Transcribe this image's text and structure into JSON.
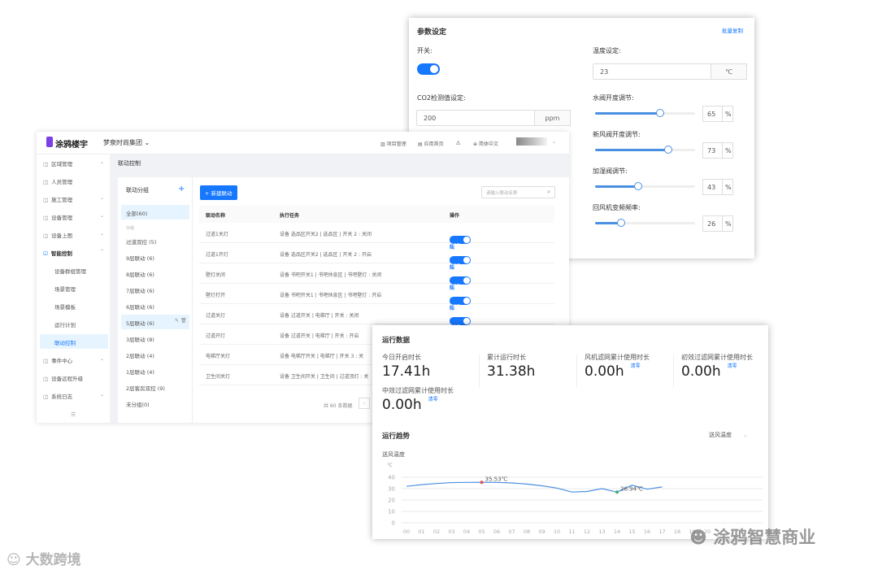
{
  "colors": {
    "accent": "#1677ff",
    "line": "#4a90e2",
    "max_point": "#e05555",
    "min_point": "#3cb371"
  },
  "header": {
    "logo": "涂鸦楼宇",
    "org": "梦泉时尚集团",
    "nav": [
      "项目管理",
      "应用首页"
    ],
    "language": "简体中文"
  },
  "sidebar": {
    "items": [
      {
        "label": "区域管理",
        "icon": "building-icon",
        "chevron": true
      },
      {
        "label": "人员管理",
        "icon": "user-icon"
      },
      {
        "label": "施工管理",
        "icon": "construction-icon",
        "chevron": true
      },
      {
        "label": "设备管理",
        "icon": "device-icon",
        "chevron": true
      },
      {
        "label": "设备上图",
        "icon": "map-pin-icon",
        "chevron": true
      },
      {
        "label": "智能控制",
        "icon": "smart-control-icon",
        "chevron": true,
        "expanded": true
      },
      {
        "label": "设备群组管理",
        "sub": true
      },
      {
        "label": "场景管理",
        "sub": true
      },
      {
        "label": "场景模板",
        "sub": true
      },
      {
        "label": "运行计划",
        "sub": true
      },
      {
        "label": "联动控制",
        "sub": true,
        "active": true
      },
      {
        "label": "事件中心",
        "icon": "event-icon",
        "chevron": true
      },
      {
        "label": "设备远程升级",
        "icon": "upgrade-icon"
      },
      {
        "label": "系统日志",
        "icon": "log-icon",
        "chevron": true
      }
    ]
  },
  "breadcrumb": "联动控制",
  "groups": {
    "title": "联动分组",
    "all": "全部(60)",
    "section": "分组",
    "items": [
      "过道双控 (5)",
      "9层联动 (6)",
      "8层联动 (6)",
      "7层联动 (6)",
      "6层联动 (6)",
      "5层联动 (6)",
      "3层联动 (8)",
      "2层联动 (4)",
      "1层联动 (4)",
      "2层客房双控 (9)",
      "未分组(0)"
    ]
  },
  "table": {
    "new_button": "+ 新建联动",
    "search_placeholder": "请输入联动名称",
    "columns": [
      "联动名称",
      "执行任务",
      "操作"
    ],
    "rows": [
      {
        "name": "过道1关灯",
        "task": "设备 选品区开关2 | 选品区 | 开关 2 : 关闭"
      },
      {
        "name": "过道1开灯",
        "task": "设备 选品区开关2 | 选品区 | 开关 2 : 开启"
      },
      {
        "name": "壁灯关闭",
        "task": "设备 书吧开关1 | 书吧休息区 | 书吧壁灯 : 关闭"
      },
      {
        "name": "壁灯打开",
        "task": "设备 书吧开关1 | 书吧休息区 | 书吧壁灯 : 开启"
      },
      {
        "name": "过道关灯",
        "task": "设备 过道开关 | 电梯厅 | 开关 : 关闭"
      },
      {
        "name": "过道开灯",
        "task": "设备 过道开关 | 电梯厅 | 开关 : 开启"
      },
      {
        "name": "电梯厅关灯",
        "task": "设备 电梯厅开关 | 电梯厅 | 开关 3 : 关"
      },
      {
        "name": "卫生间关灯",
        "task": "设备 卫生间开关 | 卫生间 | 过道顶灯 : 关"
      }
    ],
    "edit": "编辑",
    "delete": "删除",
    "enabled": "启用",
    "total": "共 60 条数据"
  },
  "params": {
    "title": "参数设定",
    "batch_copy": "批量复制",
    "switch_label": "开关:",
    "switch_on": true,
    "co2_label": "CO2检测值设定:",
    "co2_value": "200",
    "co2_unit": "ppm",
    "temp_label": "温度设定:",
    "temp_value": "23",
    "temp_unit": "℃",
    "sliders": [
      {
        "label": "水阀开度调节:",
        "value": 65
      },
      {
        "label": "新风阀开度调节:",
        "value": 73
      },
      {
        "label": "加湿阀调节:",
        "value": 43
      },
      {
        "label": "回风机变频频率:",
        "value": 26
      }
    ],
    "percent": "%"
  },
  "run": {
    "title": "运行数据",
    "clear": "清零",
    "stats": [
      {
        "label": "今日开启时长",
        "value": "17.41h"
      },
      {
        "label": "累计运行时长",
        "value": "31.38h"
      },
      {
        "label": "风机滤网累计使用时长",
        "value": "0.00h",
        "clear": true
      },
      {
        "label": "初效过滤网累计使用时长",
        "value": "0.00h",
        "clear": true
      },
      {
        "label": "中效过滤网累计使用时长",
        "value": "0.00h",
        "clear": true
      }
    ],
    "trend_title": "运行趋势",
    "select": "送风温度"
  },
  "chart_data": {
    "type": "line",
    "title": "送风温度",
    "ylabel": "℃",
    "ylim": [
      0,
      40
    ],
    "yticks": [
      0,
      10,
      20,
      30,
      40
    ],
    "grid": true,
    "x": [
      "00",
      "01",
      "02",
      "03",
      "04",
      "05",
      "06",
      "07",
      "08",
      "09",
      "10",
      "11",
      "12",
      "13",
      "14",
      "15",
      "16",
      "17",
      "18",
      "19",
      "20"
    ],
    "series": [
      {
        "values": [
          32,
          33.5,
          34.5,
          35.3,
          35.5,
          35.53,
          35.5,
          35,
          34,
          32.5,
          30.5,
          27,
          27.5,
          30,
          26.94,
          33,
          29.5,
          31.5
        ]
      }
    ],
    "annotations": [
      {
        "x": "05",
        "value": 35.53,
        "label": "35.53℃",
        "type": "max"
      },
      {
        "x": "14",
        "value": 26.94,
        "label": "26.94℃",
        "type": "min"
      }
    ]
  },
  "watermarks": [
    "大数跨境",
    "涂鸦智慧商业"
  ]
}
